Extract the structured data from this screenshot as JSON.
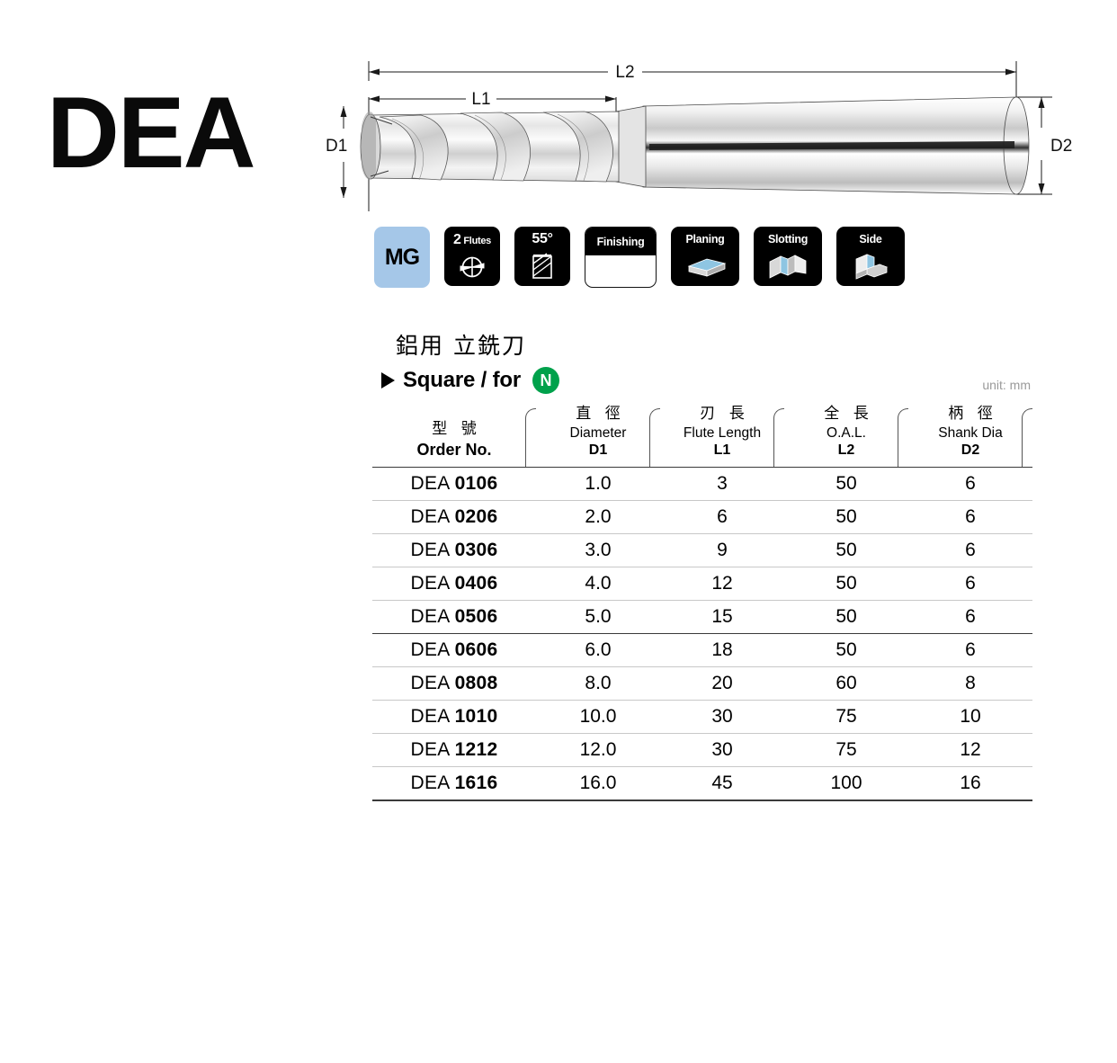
{
  "product_code": "DEA",
  "drawing": {
    "dimension_labels": {
      "d1": "D1",
      "d2": "D2",
      "l1": "L1",
      "l2": "L2"
    }
  },
  "badges": [
    {
      "id": "mg",
      "label": "MG",
      "type": "material-grade"
    },
    {
      "id": "flutes",
      "label": "Flutes",
      "count": "2"
    },
    {
      "id": "angle",
      "label": "55°"
    },
    {
      "id": "finishing",
      "label": "Finishing"
    },
    {
      "id": "planing",
      "label": "Planing"
    },
    {
      "id": "slotting",
      "label": "Slotting"
    },
    {
      "id": "side",
      "label": "Side"
    }
  ],
  "subtitle_cn": "鋁用  立銑刀",
  "type_label": "Square / for",
  "material_badge": "N",
  "unit_note": "unit: mm",
  "colors": {
    "mg_badge": "#a5c7e8",
    "n_badge": "#00a14b",
    "badge_black": "#000000",
    "unit_note": "#9a9a9a",
    "icon_blue": "#8ec5e2"
  },
  "table": {
    "columns": [
      {
        "cn": "型 號",
        "en": "Order No.",
        "sym": "",
        "en_bold": true
      },
      {
        "cn": "直 徑",
        "en": "Diameter",
        "sym": "D1",
        "en_bold": false
      },
      {
        "cn": "刃 長",
        "en": "Flute Length",
        "sym": "L1",
        "en_bold": false
      },
      {
        "cn": "全 長",
        "en": "O.A.L.",
        "sym": "L2",
        "en_bold": false
      },
      {
        "cn": "柄 徑",
        "en": "Shank Dia",
        "sym": "D2",
        "en_bold": false
      }
    ],
    "rows": [
      {
        "prefix": "DEA",
        "code": "0106",
        "d1": "1.0",
        "l1": "3",
        "l2": "50",
        "d2": "6",
        "group_end": false
      },
      {
        "prefix": "DEA",
        "code": "0206",
        "d1": "2.0",
        "l1": "6",
        "l2": "50",
        "d2": "6",
        "group_end": false
      },
      {
        "prefix": "DEA",
        "code": "0306",
        "d1": "3.0",
        "l1": "9",
        "l2": "50",
        "d2": "6",
        "group_end": false
      },
      {
        "prefix": "DEA",
        "code": "0406",
        "d1": "4.0",
        "l1": "12",
        "l2": "50",
        "d2": "6",
        "group_end": false
      },
      {
        "prefix": "DEA",
        "code": "0506",
        "d1": "5.0",
        "l1": "15",
        "l2": "50",
        "d2": "6",
        "group_end": true
      },
      {
        "prefix": "DEA",
        "code": "0606",
        "d1": "6.0",
        "l1": "18",
        "l2": "50",
        "d2": "6",
        "group_end": false
      },
      {
        "prefix": "DEA",
        "code": "0808",
        "d1": "8.0",
        "l1": "20",
        "l2": "60",
        "d2": "8",
        "group_end": false
      },
      {
        "prefix": "DEA",
        "code": "1010",
        "d1": "10.0",
        "l1": "30",
        "l2": "75",
        "d2": "10",
        "group_end": false
      },
      {
        "prefix": "DEA",
        "code": "1212",
        "d1": "12.0",
        "l1": "30",
        "l2": "75",
        "d2": "12",
        "group_end": false
      },
      {
        "prefix": "DEA",
        "code": "1616",
        "d1": "16.0",
        "l1": "45",
        "l2": "100",
        "d2": "16",
        "group_end": false
      }
    ]
  }
}
